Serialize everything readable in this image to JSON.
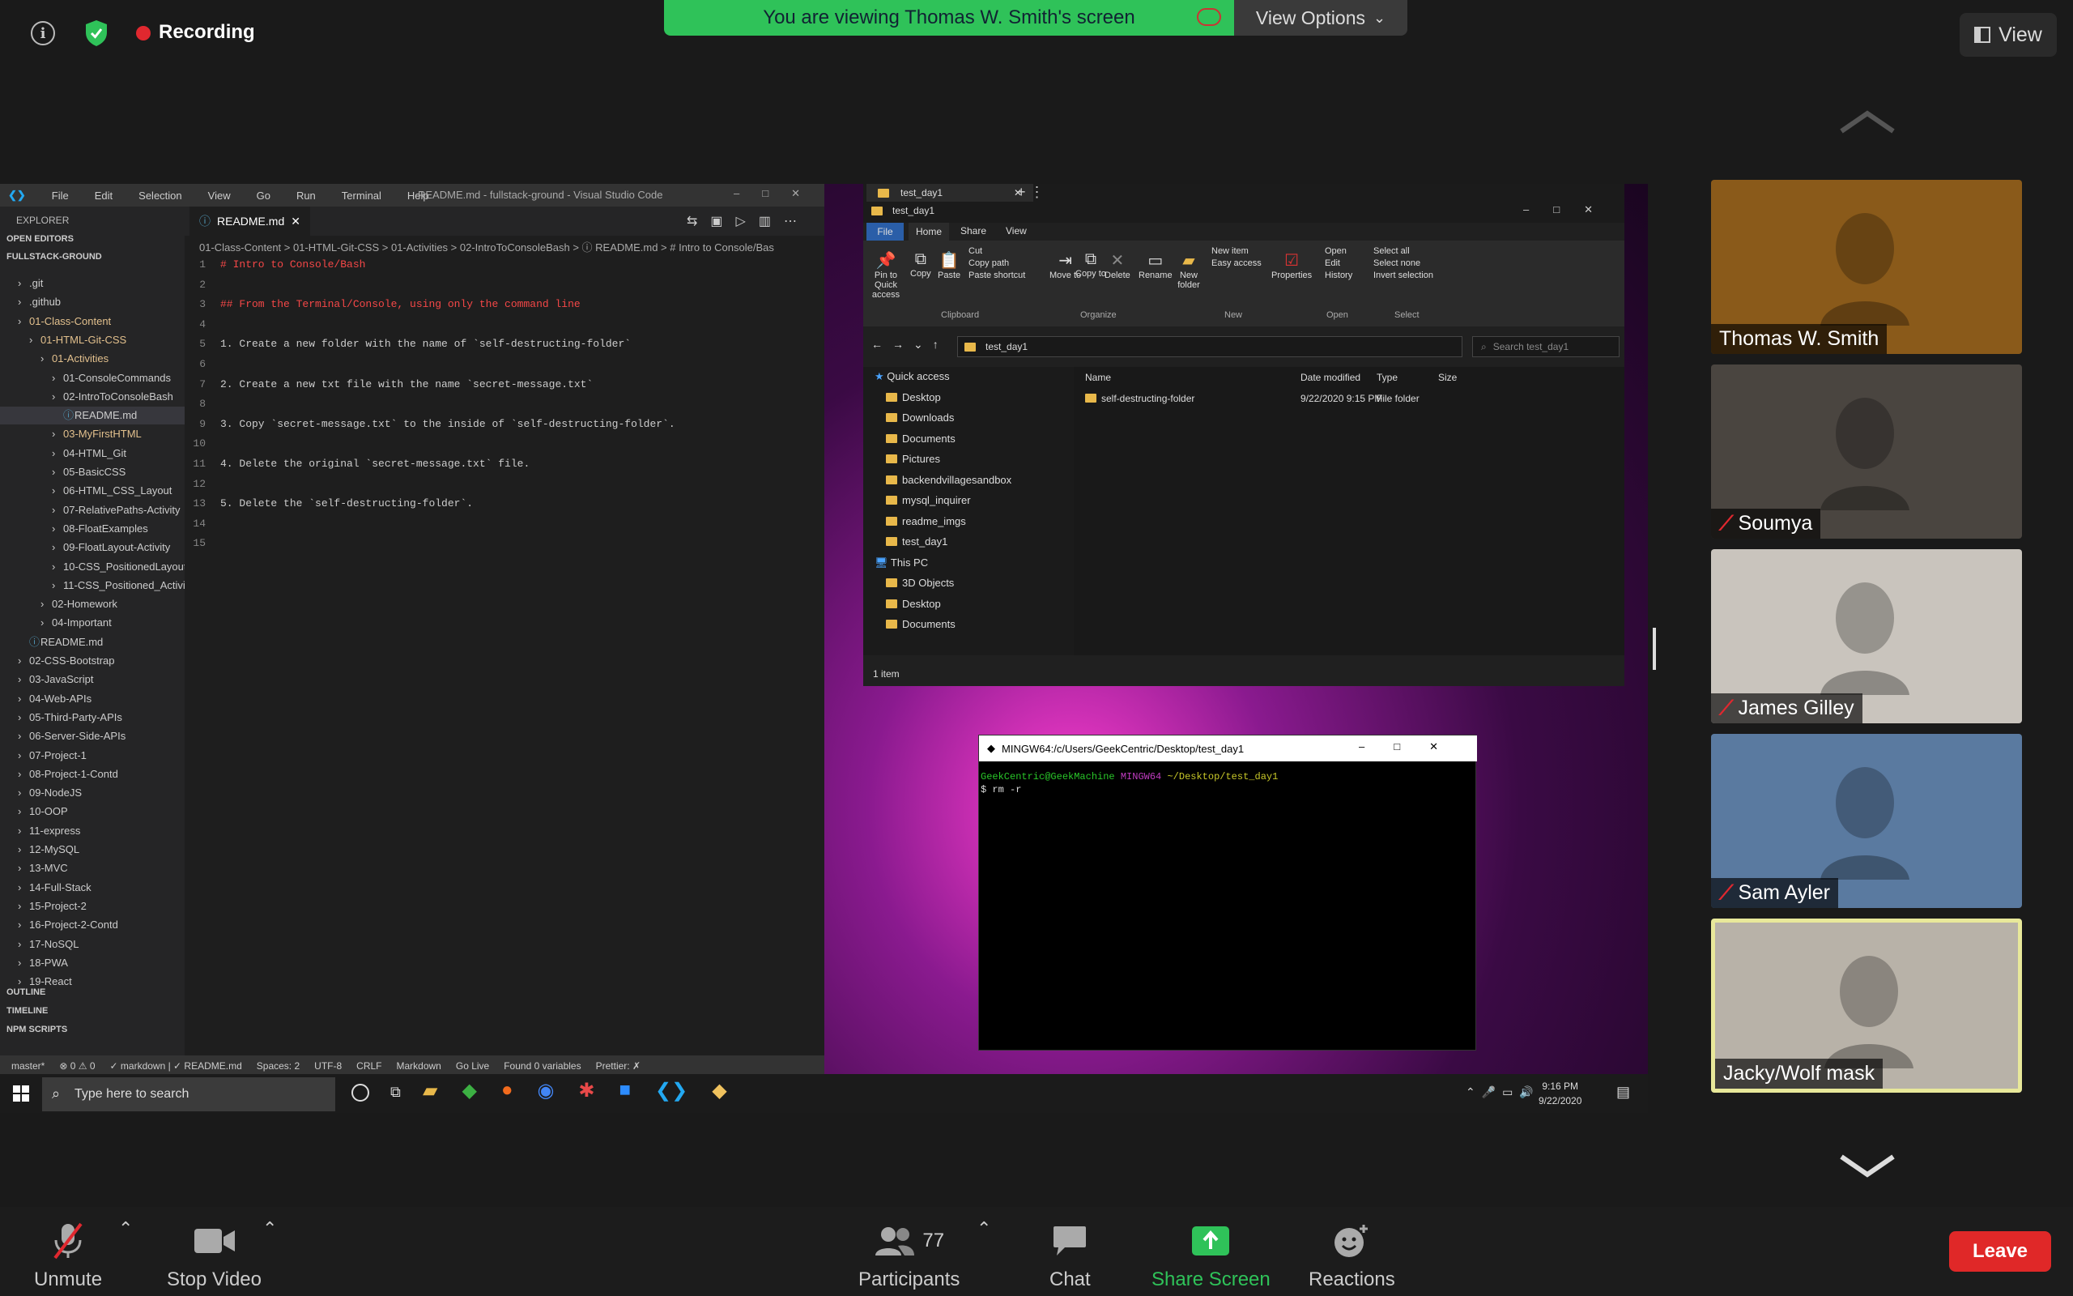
{
  "top_bar": {
    "recording_label": "Recording",
    "banner_text": "You are viewing Thomas W. Smith's screen",
    "view_options_label": "View Options",
    "view_label": "View"
  },
  "vscode": {
    "menu": [
      "File",
      "Edit",
      "Selection",
      "View",
      "Go",
      "Run",
      "Terminal",
      "Help"
    ],
    "window_title": "README.md - fullstack-ground - Visual Studio Code",
    "explorer_label": "EXPLORER",
    "open_editors": "OPEN EDITORS",
    "workspace": "FULLSTACK-GROUND",
    "tree": [
      {
        "label": ".git",
        "indent": 1
      },
      {
        "label": ".github",
        "indent": 1
      },
      {
        "label": "01-Class-Content",
        "indent": 1,
        "mod": true
      },
      {
        "label": "01-HTML-Git-CSS",
        "indent": 2,
        "mod": true
      },
      {
        "label": "01-Activities",
        "indent": 3,
        "mod": true
      },
      {
        "label": "01-ConsoleCommands",
        "indent": 4
      },
      {
        "label": "02-IntroToConsoleBash",
        "indent": 4
      },
      {
        "label": "README.md",
        "indent": 5,
        "sel": true
      },
      {
        "label": "03-MyFirstHTML",
        "indent": 4,
        "mod": true
      },
      {
        "label": "04-HTML_Git",
        "indent": 4
      },
      {
        "label": "05-BasicCSS",
        "indent": 4
      },
      {
        "label": "06-HTML_CSS_Layout",
        "indent": 4
      },
      {
        "label": "07-RelativePaths-Activity",
        "indent": 4
      },
      {
        "label": "08-FloatExamples",
        "indent": 4
      },
      {
        "label": "09-FloatLayout-Activity",
        "indent": 4
      },
      {
        "label": "10-CSS_PositionedLayout",
        "indent": 4
      },
      {
        "label": "11-CSS_Positioned_Activity",
        "indent": 4
      },
      {
        "label": "02-Homework",
        "indent": 3
      },
      {
        "label": "04-Important",
        "indent": 3
      },
      {
        "label": "README.md",
        "indent": 2
      },
      {
        "label": "02-CSS-Bootstrap",
        "indent": 1
      },
      {
        "label": "03-JavaScript",
        "indent": 1
      },
      {
        "label": "04-Web-APIs",
        "indent": 1
      },
      {
        "label": "05-Third-Party-APIs",
        "indent": 1
      },
      {
        "label": "06-Server-Side-APIs",
        "indent": 1
      },
      {
        "label": "07-Project-1",
        "indent": 1
      },
      {
        "label": "08-Project-1-Contd",
        "indent": 1
      },
      {
        "label": "09-NodeJS",
        "indent": 1
      },
      {
        "label": "10-OOP",
        "indent": 1
      },
      {
        "label": "11-express",
        "indent": 1
      },
      {
        "label": "12-MySQL",
        "indent": 1
      },
      {
        "label": "13-MVC",
        "indent": 1
      },
      {
        "label": "14-Full-Stack",
        "indent": 1
      },
      {
        "label": "15-Project-2",
        "indent": 1
      },
      {
        "label": "16-Project-2-Contd",
        "indent": 1
      },
      {
        "label": "17-NoSQL",
        "indent": 1
      },
      {
        "label": "18-PWA",
        "indent": 1
      },
      {
        "label": "19-React",
        "indent": 1
      }
    ],
    "outline": "OUTLINE",
    "timeline": "TIMELINE",
    "npm_scripts": "NPM SCRIPTS",
    "tab_label": "README.md",
    "breadcrumb": "01-Class-Content > 01-HTML-Git-CSS > 01-Activities > 02-IntroToConsoleBash > ⓘ README.md > # Intro to Console/Bas",
    "code": [
      {
        "n": "1",
        "text": "# Intro to Console/Bash",
        "color": "#f44747"
      },
      {
        "n": "2",
        "text": "",
        "color": "#ccc"
      },
      {
        "n": "3",
        "text": "## From the Terminal/Console, using only the command line",
        "color": "#f44747"
      },
      {
        "n": "4",
        "text": "",
        "color": "#ccc"
      },
      {
        "n": "5",
        "text": "1. Create a new folder with the name of `self-destructing-folder`",
        "color": "#ccc"
      },
      {
        "n": "6",
        "text": "",
        "color": "#ccc"
      },
      {
        "n": "7",
        "text": "2. Create a new txt file with the name `secret-message.txt`",
        "color": "#ccc"
      },
      {
        "n": "8",
        "text": "",
        "color": "#ccc"
      },
      {
        "n": "9",
        "text": "3. Copy `secret-message.txt` to the inside of `self-destructing-folder`.",
        "color": "#ccc"
      },
      {
        "n": "10",
        "text": "",
        "color": "#ccc"
      },
      {
        "n": "11",
        "text": "4. Delete the original `secret-message.txt` file.",
        "color": "#ccc"
      },
      {
        "n": "12",
        "text": "",
        "color": "#ccc"
      },
      {
        "n": "13",
        "text": "5. Delete the `self-destructing-folder`.",
        "color": "#ccc"
      },
      {
        "n": "14",
        "text": "",
        "color": "#ccc"
      },
      {
        "n": "15",
        "text": "",
        "color": "#ccc"
      }
    ],
    "status": [
      "master*",
      "⊗ 0 ⚠ 0",
      "✓ markdown | ✓ README.md",
      "Spaces: 2",
      "UTF-8",
      "CRLF",
      "Markdown",
      "Go Live",
      "Found 0 variables",
      "Prettier: ✗"
    ]
  },
  "explorer": {
    "tab_title": "test_day1",
    "window_title": "test_day1",
    "ribbon_tabs": [
      "File",
      "Home",
      "Share",
      "View"
    ],
    "ribbon_groups": [
      "Clipboard",
      "Organize",
      "New",
      "Open",
      "Select"
    ],
    "ribbon_buttons": {
      "pin": "Pin to Quick access",
      "copy": "Copy",
      "paste": "Paste",
      "cut": "Cut",
      "copy_path": "Copy path",
      "paste_shortcut": "Paste shortcut",
      "move_to": "Move to",
      "copy_to": "Copy to",
      "delete": "Delete",
      "rename": "Rename",
      "new_folder": "New folder",
      "new_item": "New item",
      "easy_access": "Easy access",
      "properties": "Properties",
      "open": "Open",
      "edit": "Edit",
      "history": "History",
      "select_all": "Select all",
      "select_none": "Select none",
      "invert_selection": "Invert selection"
    },
    "address": "test_day1",
    "search_placeholder": "Search test_day1",
    "nav": [
      {
        "label": "Quick access",
        "indent": 0
      },
      {
        "label": "Desktop",
        "indent": 1
      },
      {
        "label": "Downloads",
        "indent": 1
      },
      {
        "label": "Documents",
        "indent": 1
      },
      {
        "label": "Pictures",
        "indent": 1
      },
      {
        "label": "backendvillagesandbox",
        "indent": 1
      },
      {
        "label": "mysql_inquirer",
        "indent": 1
      },
      {
        "label": "readme_imgs",
        "indent": 1
      },
      {
        "label": "test_day1",
        "indent": 1
      },
      {
        "label": "This PC",
        "indent": 0
      },
      {
        "label": "3D Objects",
        "indent": 1
      },
      {
        "label": "Desktop",
        "indent": 1
      },
      {
        "label": "Documents",
        "indent": 1
      }
    ],
    "columns": [
      "Name",
      "Date modified",
      "Type",
      "Size"
    ],
    "rows": [
      {
        "name": "self-destructing-folder",
        "date": "9/22/2020 9:15 PM",
        "type": "File folder",
        "size": ""
      }
    ],
    "status": "1 item"
  },
  "terminal": {
    "title": "MINGW64:/c/Users/GeekCentric/Desktop/test_day1",
    "user": "GeekCentric@GeekMachine",
    "shell": "MINGW64",
    "path": "~/Desktop/test_day1",
    "command": "$ rm -r"
  },
  "taskbar": {
    "search_placeholder": "Type here to search",
    "time": "9:16 PM",
    "date": "9/22/2020"
  },
  "participants": [
    {
      "name": "Thomas W. Smith",
      "muted": false,
      "bg": "#8a5a1a"
    },
    {
      "name": "Soumya",
      "muted": true,
      "bg": "#4a4540"
    },
    {
      "name": "James Gilley",
      "muted": true,
      "bg": "#c9c4bd"
    },
    {
      "name": "Sam Ayler",
      "muted": true,
      "bg": "#5a7aa0"
    },
    {
      "name": "Jacky/Wolf mask",
      "muted": false,
      "bg": "#b8b2a8"
    }
  ],
  "bottom": {
    "unmute": "Unmute",
    "stop_video": "Stop Video",
    "participants_label": "Participants",
    "participants_count": "77",
    "chat": "Chat",
    "share_screen": "Share Screen",
    "reactions": "Reactions",
    "leave": "Leave"
  },
  "colors": {
    "banner": "#2fc259",
    "share_screen": "#2fc259",
    "leave": "#e02828",
    "recording_dot": "#e0282f",
    "active_speaker_border": "#e8e89a"
  }
}
